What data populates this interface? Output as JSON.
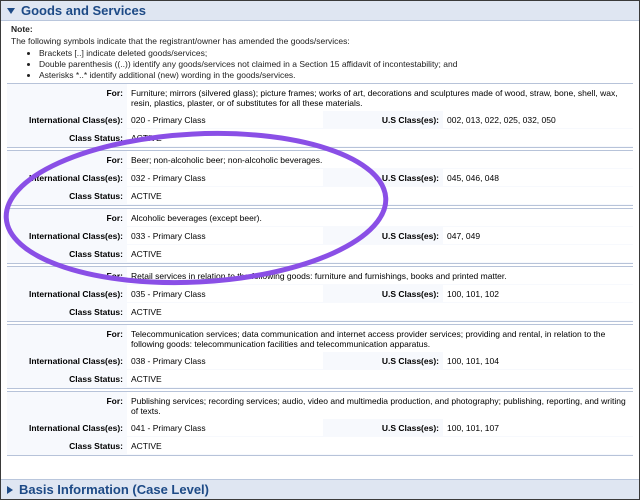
{
  "section": {
    "title": "Goods and Services"
  },
  "note": {
    "title": "Note:",
    "intro": "The following symbols indicate that the registrant/owner has amended the goods/services:",
    "items": [
      "Brackets [..] indicate deleted goods/services;",
      "Double parenthesis ((..)) identify any goods/services not claimed in a Section 15 affidavit of incontestability; and",
      "Asterisks *..* identify additional (new) wording in the goods/services."
    ]
  },
  "labels": {
    "for": "For:",
    "intl": "International Class(es):",
    "us": "U.S Class(es):",
    "status": "Class Status:"
  },
  "blocks": [
    {
      "for": "Furniture; mirrors (silvered glass); picture frames; works of art, decorations and sculptures made of wood, straw, bone, shell, wax, resin, plastics, plaster, or of substitutes for all these materials.",
      "intl": "020 - Primary Class",
      "us": "002, 013, 022, 025, 032, 050",
      "status": "ACTIVE"
    },
    {
      "for": "Beer; non-alcoholic beer; non-alcoholic beverages.",
      "intl": "032 - Primary Class",
      "us": "045, 046, 048",
      "status": "ACTIVE"
    },
    {
      "for": "Alcoholic beverages (except beer).",
      "intl": "033 - Primary Class",
      "us": "047, 049",
      "status": "ACTIVE"
    },
    {
      "for": "Retail services in relation to the following goods: furniture and furnishings, books and printed matter.",
      "intl": "035 - Primary Class",
      "us": "100, 101, 102",
      "status": "ACTIVE"
    },
    {
      "for": "Telecommunication services; data communication and internet access provider services; providing and rental, in relation to the following goods: telecommunication facilities and telecommunication apparatus.",
      "intl": "038 - Primary Class",
      "us": "100, 101, 104",
      "status": "ACTIVE"
    },
    {
      "for": "Publishing services; recording services; audio, video and multimedia production, and photography; publishing, reporting, and writing of texts.",
      "intl": "041 - Primary Class",
      "us": "100, 101, 107",
      "status": "ACTIVE"
    }
  ],
  "basis": {
    "title": "Basis Information (Case Level)"
  },
  "colors": {
    "header_bg": "#dfe6f2",
    "header_text": "#1d4a86",
    "annotation": "#8a4fe6"
  }
}
